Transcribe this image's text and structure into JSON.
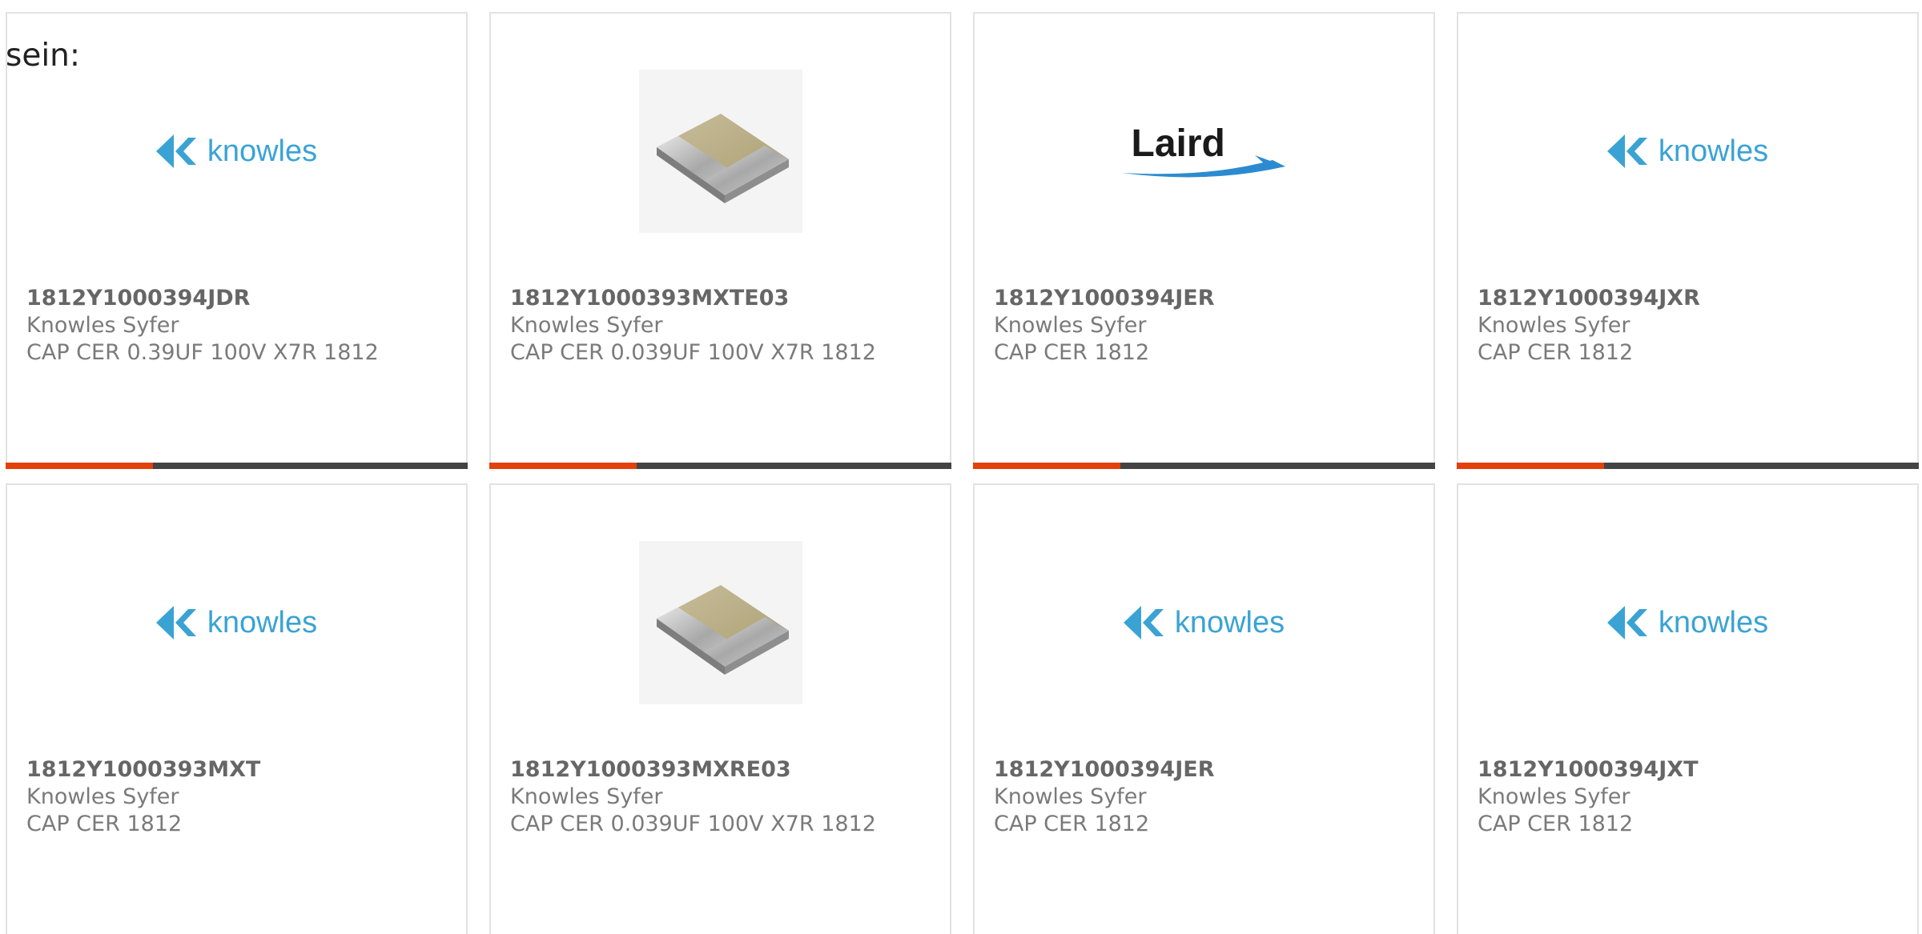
{
  "intro": {
    "text": "sein:"
  },
  "colors": {
    "accent_bar": "#e4400b",
    "bar": "#444444",
    "knowles_blue": "#3aa3d4",
    "card_border": "#e2e2e2"
  },
  "products": [
    {
      "part_number": "1812Y1000394JDR",
      "manufacturer": "Knowles Syfer",
      "description": "CAP CER 0.39UF 100V X7R 1812",
      "image": "knowles-logo",
      "logo_text": "knowles"
    },
    {
      "part_number": "1812Y1000393MXTE03",
      "manufacturer": "Knowles Syfer",
      "description": "CAP CER 0.039UF 100V X7R 1812",
      "image": "chip-capacitor"
    },
    {
      "part_number": "1812Y1000394JER",
      "manufacturer": "Knowles Syfer",
      "description": "CAP CER 1812",
      "image": "laird-logo",
      "logo_text": "Laird"
    },
    {
      "part_number": "1812Y1000394JXR",
      "manufacturer": "Knowles Syfer",
      "description": "CAP CER 1812",
      "image": "knowles-logo",
      "logo_text": "knowles"
    },
    {
      "part_number": "1812Y1000393MXT",
      "manufacturer": "Knowles Syfer",
      "description": "CAP CER 1812",
      "image": "knowles-logo",
      "logo_text": "knowles"
    },
    {
      "part_number": "1812Y1000393MXRE03",
      "manufacturer": "Knowles Syfer",
      "description": "CAP CER 0.039UF 100V X7R 1812",
      "image": "chip-capacitor"
    },
    {
      "part_number": "1812Y1000394JER",
      "manufacturer": "Knowles Syfer",
      "description": "CAP CER 1812",
      "image": "knowles-logo",
      "logo_text": "knowles"
    },
    {
      "part_number": "1812Y1000394JXT",
      "manufacturer": "Knowles Syfer",
      "description": "CAP CER 1812",
      "image": "knowles-logo",
      "logo_text": "knowles"
    }
  ]
}
